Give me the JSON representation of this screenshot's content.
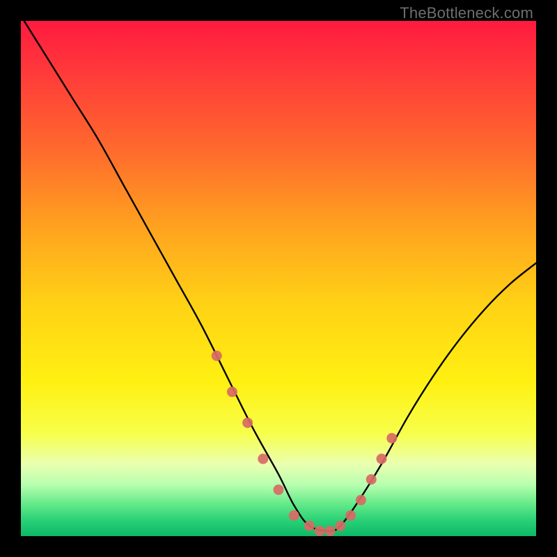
{
  "watermark": "TheBottleneck.com",
  "chart_data": {
    "type": "line",
    "title": "",
    "xlabel": "",
    "ylabel": "",
    "xlim": [
      0,
      100
    ],
    "ylim": [
      0,
      100
    ],
    "series": [
      {
        "name": "bottleneck-curve",
        "x": [
          0,
          5,
          10,
          15,
          20,
          25,
          30,
          35,
          40,
          45,
          50,
          53,
          56,
          60,
          62,
          65,
          70,
          75,
          80,
          85,
          90,
          95,
          100
        ],
        "values": [
          101,
          93,
          85,
          77,
          68,
          59,
          50,
          41,
          31,
          21,
          12,
          6,
          2,
          1,
          2,
          6,
          14,
          23,
          31,
          38,
          44,
          49,
          53
        ]
      }
    ],
    "markers": {
      "name": "emphasis-dots",
      "color": "#d86a64",
      "x": [
        38,
        41,
        44,
        47,
        50,
        53,
        56,
        58,
        60,
        62,
        64,
        66,
        68,
        70,
        72
      ],
      "values": [
        35,
        28,
        22,
        15,
        9,
        4,
        2,
        1,
        1,
        2,
        4,
        7,
        11,
        15,
        19
      ]
    },
    "gradient_stops": [
      {
        "offset": 0.0,
        "color": "#ff1a3f"
      },
      {
        "offset": 0.1,
        "color": "#ff3a3a"
      },
      {
        "offset": 0.25,
        "color": "#ff6a2d"
      },
      {
        "offset": 0.4,
        "color": "#ffa21f"
      },
      {
        "offset": 0.55,
        "color": "#ffd215"
      },
      {
        "offset": 0.7,
        "color": "#fff012"
      },
      {
        "offset": 0.8,
        "color": "#f7ff4a"
      },
      {
        "offset": 0.86,
        "color": "#eaffb0"
      },
      {
        "offset": 0.9,
        "color": "#b8ffb0"
      },
      {
        "offset": 0.94,
        "color": "#5fe887"
      },
      {
        "offset": 0.97,
        "color": "#28d077"
      },
      {
        "offset": 1.0,
        "color": "#0fb865"
      }
    ]
  }
}
